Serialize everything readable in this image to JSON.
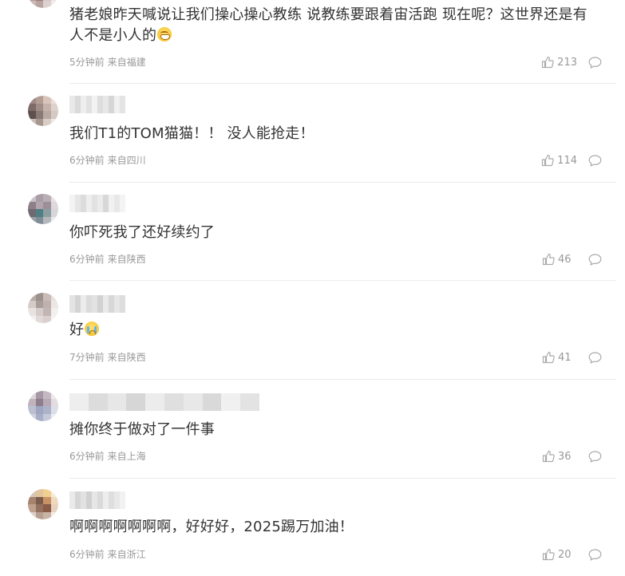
{
  "colors": {
    "text": "#333333",
    "meta": "#999999",
    "divider": "#ececec",
    "icon": "#aaaaaa"
  },
  "icons": {
    "like": "thumbs-up-icon",
    "reply": "comment-bubble-icon"
  },
  "comments": [
    {
      "content": "猪老娘昨天喊说让我们操心操心教练 说教练要跟着宙活跑 现在呢？这世界还是有人不是小人的",
      "emoji": "grin",
      "time": "5分钟前",
      "location": "来自福建",
      "likes": "213"
    },
    {
      "content": "我们T1的TOM猫猫！！ 没人能抢走！",
      "time": "6分钟前",
      "location": "来自四川",
      "likes": "114"
    },
    {
      "content": "你吓死我了还好续约了",
      "time": "6分钟前",
      "location": "来自陕西",
      "likes": "46"
    },
    {
      "content": "好",
      "emoji": "cry",
      "time": "7分钟前",
      "location": "来自陕西",
      "likes": "41"
    },
    {
      "content": "摊你终于做对了一件事",
      "time": "6分钟前",
      "location": "来自上海",
      "likes": "36"
    },
    {
      "content": "啊啊啊啊啊啊啊，好好好，2025踢万加油！",
      "time": "6分钟前",
      "location": "来自浙江",
      "likes": "20"
    }
  ]
}
